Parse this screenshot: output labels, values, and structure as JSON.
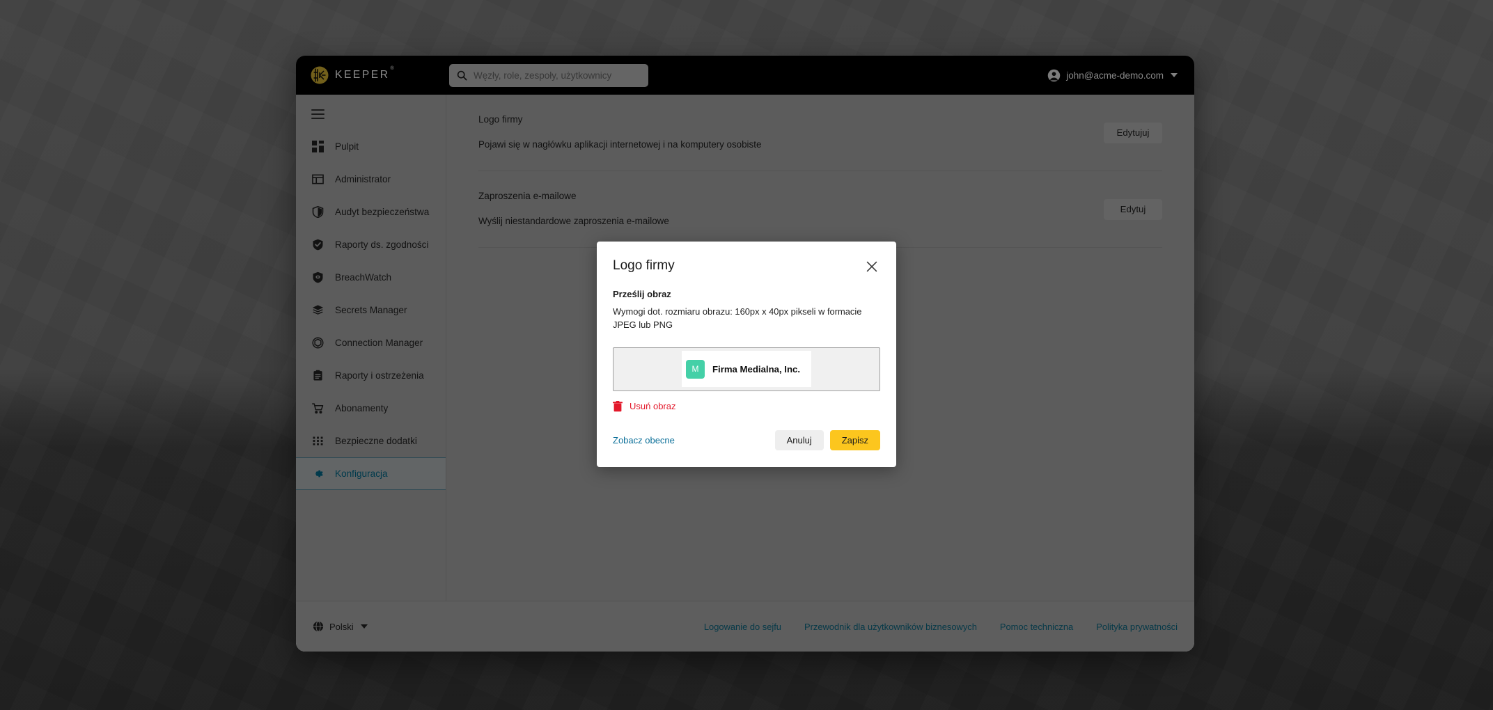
{
  "header": {
    "brand_name": "KEEPER",
    "brand_trademark": "®",
    "brand_icon": "keeper-logo-icon",
    "search": {
      "icon": "search-icon",
      "placeholder": "Węzły, role, zespoły, użytkownicy",
      "value": ""
    },
    "account": {
      "icon": "user-avatar-icon",
      "email": "john@acme-demo.com",
      "caret_icon": "chevron-down-icon"
    }
  },
  "sidebar": {
    "menu_toggle_icon": "hamburger-menu-icon",
    "items": [
      {
        "label": "Pulpit",
        "icon": "dashboard-icon",
        "active": false
      },
      {
        "label": "Administrator",
        "icon": "admin-panel-icon",
        "active": false
      },
      {
        "label": "Audyt bezpieczeństwa",
        "icon": "shield-half-icon",
        "active": false
      },
      {
        "label": "Raporty ds. zgodności",
        "icon": "shield-check-icon",
        "active": false
      },
      {
        "label": "BreachWatch",
        "icon": "shield-eye-icon",
        "active": false
      },
      {
        "label": "Secrets Manager",
        "icon": "layers-icon",
        "active": false
      },
      {
        "label": "Connection Manager",
        "icon": "hexagon-icon",
        "active": false
      },
      {
        "label": "Raporty i ostrzeżenia",
        "icon": "clipboard-icon",
        "active": false
      },
      {
        "label": "Abonamenty",
        "icon": "shopping-cart-icon",
        "active": false
      },
      {
        "label": "Bezpieczne dodatki",
        "icon": "grid-dots-icon",
        "active": false
      },
      {
        "label": "Konfiguracja",
        "icon": "gear-icon",
        "active": true
      }
    ]
  },
  "main": {
    "rows": [
      {
        "title": "Logo firmy",
        "description": "Pojawi się w nagłówku aplikacji internetowej i na komputery osobiste",
        "button": "Edytujuj"
      },
      {
        "title": "Zaproszenia e-mailowe",
        "description": "Wyślij niestandardowe zaproszenia e-mailowe",
        "button": "Edytuj"
      }
    ]
  },
  "footer": {
    "language": {
      "icon": "globe-icon",
      "label": "Polski",
      "caret_icon": "chevron-down-icon"
    },
    "links": [
      "Logowanie do sejfu",
      "Przewodnik dla użytkowników biznesowych",
      "Pomoc techniczna",
      "Polityka prywatności"
    ]
  },
  "modal": {
    "title": "Logo firmy",
    "close_icon": "close-icon",
    "subtitle": "Prześlij obraz",
    "hint": "Wymogi dot. rozmiaru obrazu: 160px x 40px pikseli w formacie JPEG lub PNG",
    "preview": {
      "badge_letter": "M",
      "company_name": "Firma Medialna, Inc."
    },
    "remove": {
      "icon": "trash-icon",
      "label": "Usuń obraz"
    },
    "view_current_label": "Zobacz obecne",
    "cancel_label": "Anuluj",
    "save_label": "Zapisz"
  },
  "colors": {
    "brand_gold": "#bfa12e",
    "accent_yellow": "#fcc61e",
    "danger_red": "#e3192b",
    "link_blue": "#0b5f78",
    "active_teal": "#00617f",
    "badge_green": "#44d0a7"
  }
}
